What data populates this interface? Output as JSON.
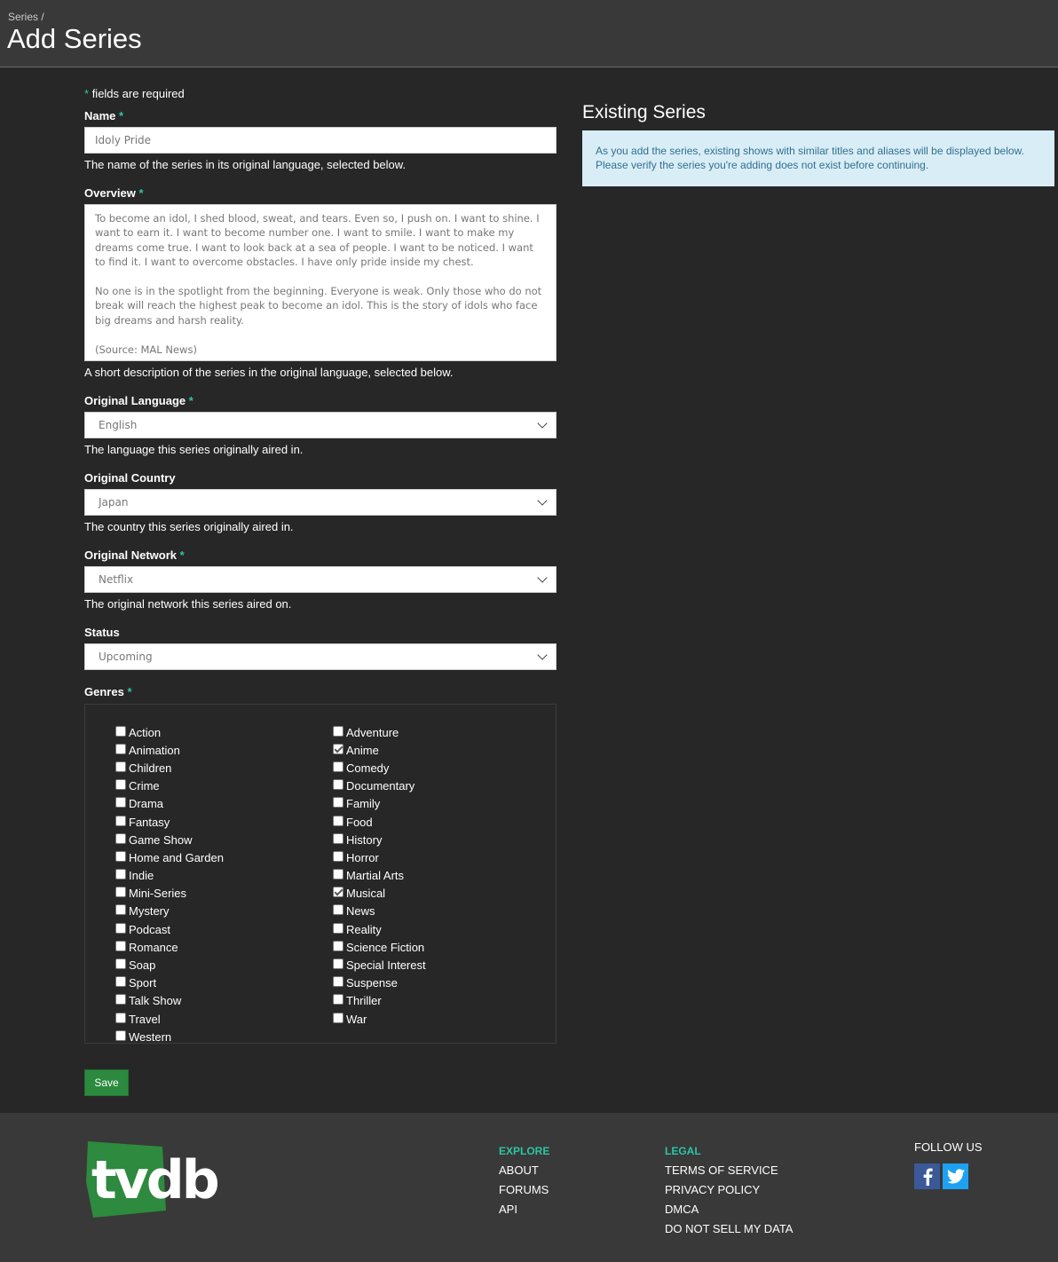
{
  "header": {
    "breadcrumb": "Series /",
    "title": "Add Series"
  },
  "form": {
    "required_note": "fields are required",
    "name": {
      "label": "Name",
      "value": "Idoly Pride",
      "help": "The name of the series in its original language, selected below."
    },
    "overview": {
      "label": "Overview",
      "paragraphs": [
        "To become an idol, I shed blood, sweat, and tears. Even so, I push on. I want to shine. I want to earn it. I want to become number one. I want to smile. I want to make my dreams come true. I want to look back at a sea of people. I want to be noticed. I want to find it. I want to overcome obstacles. I have only pride inside my chest.",
        "No one is in the spotlight from the beginning. Everyone is weak. Only those who do not break will reach the highest peak to become an idol. This is the story of idols who face big dreams and harsh reality.",
        "(Source: MAL News)"
      ],
      "help": "A short description of the series in the original language, selected below."
    },
    "language": {
      "label": "Original Language",
      "value": "English",
      "help": "The language this series originally aired in."
    },
    "country": {
      "label": "Original Country",
      "value": "Japan",
      "help": "The country this series originally aired in."
    },
    "network": {
      "label": "Original Network",
      "value": "Netflix",
      "help": "The original network this series aired on."
    },
    "status": {
      "label": "Status",
      "value": "Upcoming"
    },
    "genres": {
      "label": "Genres",
      "col1": [
        {
          "label": "Action",
          "checked": false
        },
        {
          "label": "Animation",
          "checked": false
        },
        {
          "label": "Children",
          "checked": false
        },
        {
          "label": "Crime",
          "checked": false
        },
        {
          "label": "Drama",
          "checked": false
        },
        {
          "label": "Fantasy",
          "checked": false
        },
        {
          "label": "Game Show",
          "checked": false
        },
        {
          "label": "Home and Garden",
          "checked": false
        },
        {
          "label": "Indie",
          "checked": false
        },
        {
          "label": "Mini-Series",
          "checked": false
        },
        {
          "label": "Mystery",
          "checked": false
        },
        {
          "label": "Podcast",
          "checked": false
        },
        {
          "label": "Romance",
          "checked": false
        },
        {
          "label": "Soap",
          "checked": false
        },
        {
          "label": "Sport",
          "checked": false
        },
        {
          "label": "Talk Show",
          "checked": false
        },
        {
          "label": "Travel",
          "checked": false
        },
        {
          "label": "Western",
          "checked": false
        }
      ],
      "col2": [
        {
          "label": "Adventure",
          "checked": false
        },
        {
          "label": "Anime",
          "checked": true
        },
        {
          "label": "Comedy",
          "checked": false
        },
        {
          "label": "Documentary",
          "checked": false
        },
        {
          "label": "Family",
          "checked": false
        },
        {
          "label": "Food",
          "checked": false
        },
        {
          "label": "History",
          "checked": false
        },
        {
          "label": "Horror",
          "checked": false
        },
        {
          "label": "Martial Arts",
          "checked": false
        },
        {
          "label": "Musical",
          "checked": true
        },
        {
          "label": "News",
          "checked": false
        },
        {
          "label": "Reality",
          "checked": false
        },
        {
          "label": "Science Fiction",
          "checked": false
        },
        {
          "label": "Special Interest",
          "checked": false
        },
        {
          "label": "Suspense",
          "checked": false
        },
        {
          "label": "Thriller",
          "checked": false
        },
        {
          "label": "War",
          "checked": false
        }
      ]
    },
    "save_label": "Save"
  },
  "existing": {
    "title": "Existing Series",
    "info": "As you add the series, existing shows with similar titles and aliases will be displayed below. Please verify the series you're adding does not exist before continuing."
  },
  "footer": {
    "logo_text": "tvdb",
    "explore": {
      "heading": "EXPLORE",
      "links": [
        "ABOUT",
        "FORUMS",
        "API"
      ]
    },
    "legal": {
      "heading": "LEGAL",
      "links": [
        "TERMS OF SERVICE",
        "PRIVACY POLICY",
        "DMCA",
        "DO NOT SELL MY DATA"
      ]
    },
    "follow_label": "FOLLOW US",
    "colors": {
      "accent": "#2ec4a6",
      "logo_green": "#2d8a3e",
      "facebook": "#3b5998",
      "twitter": "#1da1f2"
    }
  }
}
